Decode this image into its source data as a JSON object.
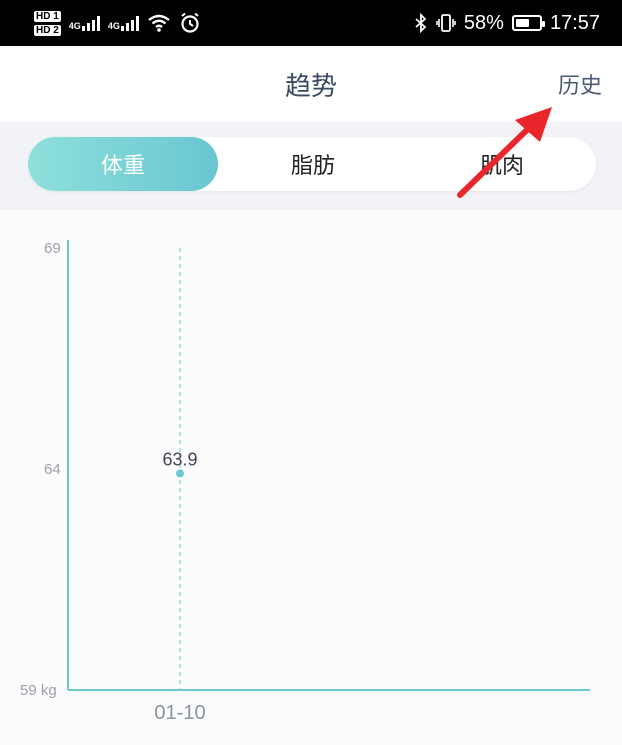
{
  "status_bar": {
    "sim1": "HD 1",
    "sim2": "HD 2",
    "net1": "4G",
    "net2": "4G",
    "icons": [
      "wifi-icon",
      "alarm-icon",
      "bluetooth-icon",
      "vibrate-icon",
      "battery-icon"
    ],
    "battery": "58%",
    "time": "17:57"
  },
  "header": {
    "title": "趋势",
    "history_label": "历史"
  },
  "tabs": [
    {
      "label": "体重",
      "active": true
    },
    {
      "label": "脂肪",
      "active": false
    },
    {
      "label": "肌肉",
      "active": false
    }
  ],
  "colors": {
    "accent": "#6cc8d3",
    "accent_light": "#8ee0da",
    "arrow": "#e8262b"
  },
  "chart_data": {
    "type": "scatter",
    "x": [
      "01-10"
    ],
    "series": [
      {
        "values": [
          63.9
        ]
      }
    ],
    "ylim": [
      59,
      69
    ],
    "yticks": [
      "69",
      "64",
      "59 kg"
    ],
    "data_labels": [
      "63.9"
    ],
    "grid": false
  }
}
